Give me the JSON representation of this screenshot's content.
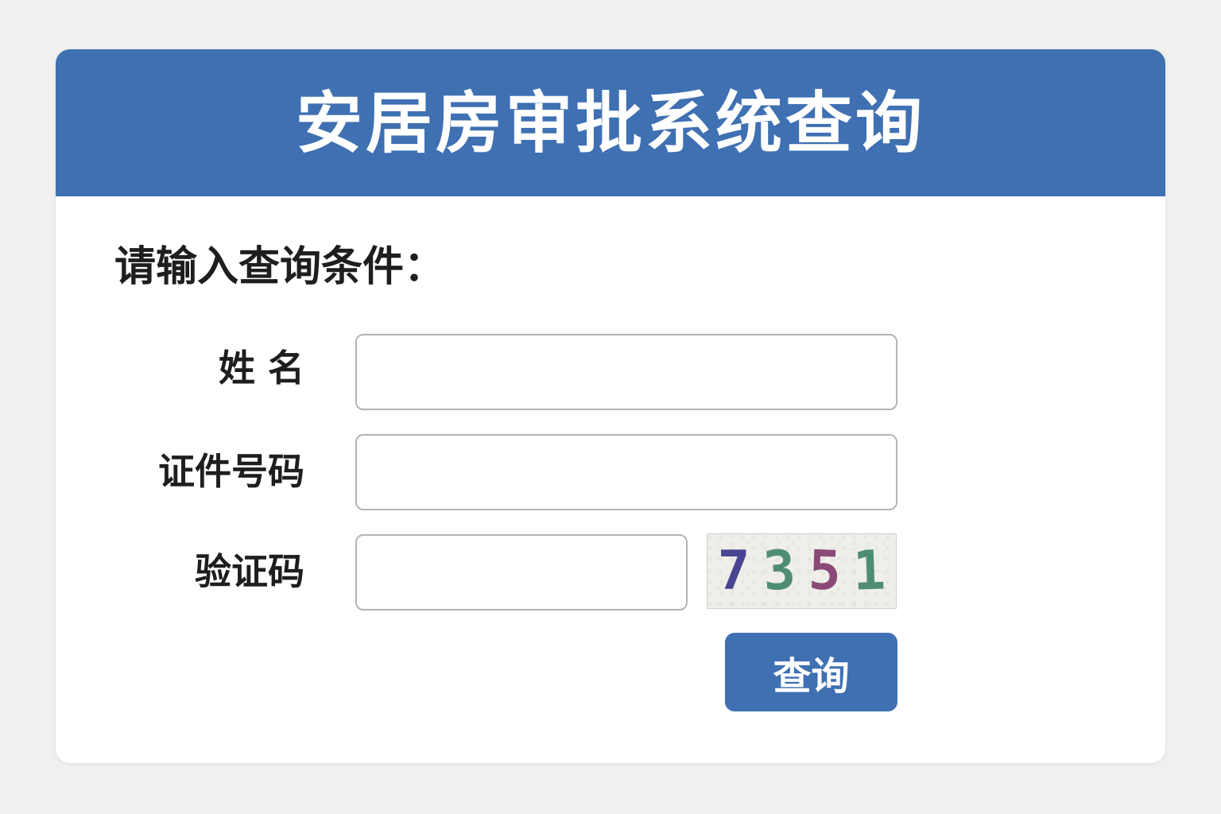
{
  "header": {
    "title": "安居房审批系统查询"
  },
  "form": {
    "prompt": "请输入查询条件：",
    "name_label": "姓 名",
    "name_value": "",
    "id_label": "证件号码",
    "id_value": "",
    "captcha_label": "验证码",
    "captcha_value": "",
    "captcha_digits": [
      "7",
      "3",
      "5",
      "1"
    ],
    "captcha_colors": [
      "#4a4590",
      "#4f8d72",
      "#8a4a78",
      "#4f8d72"
    ],
    "submit_label": "查询"
  },
  "colors": {
    "accent": "#3f70b2",
    "background": "#f1f0ee"
  }
}
